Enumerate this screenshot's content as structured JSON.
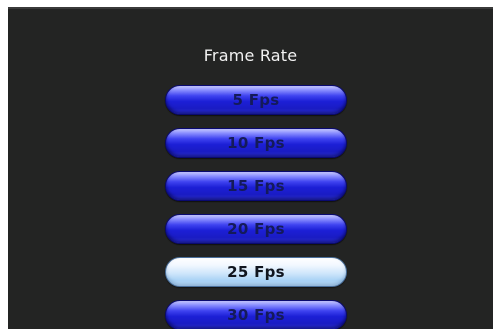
{
  "menu": {
    "title": "Frame Rate",
    "options": [
      {
        "label": "5 Fps",
        "selected": false
      },
      {
        "label": "10 Fps",
        "selected": false
      },
      {
        "label": "15 Fps",
        "selected": false
      },
      {
        "label": "20 Fps",
        "selected": false
      },
      {
        "label": "25 Fps",
        "selected": true
      },
      {
        "label": "30 Fps",
        "selected": false
      }
    ]
  },
  "colors": {
    "background": "#232423",
    "button_blue": "#1c1fd6",
    "button_selected": "#cfe6fb",
    "title_text": "#f2f2f2"
  }
}
